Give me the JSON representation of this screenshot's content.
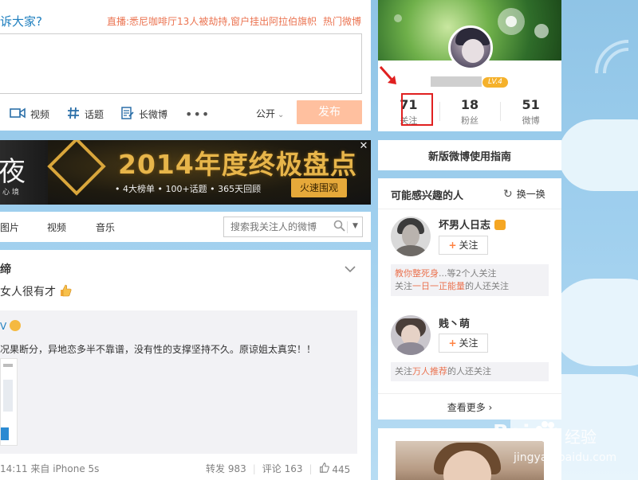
{
  "publisher": {
    "prompt": "诉大家?",
    "news": "直播:悉尼咖啡厅13人被劫持,窗户挂出阿拉伯旗帜",
    "hot": "热门微博",
    "tools": [
      {
        "label": "视频",
        "icon": "video-icon"
      },
      {
        "label": "话题",
        "icon": "hashtag-icon"
      },
      {
        "label": "长微博",
        "icon": "long-post-icon"
      }
    ],
    "more": "•••",
    "visibility": "公开",
    "publish": "发布"
  },
  "banner": {
    "left_big": "夜",
    "left_small": "心 境",
    "title": "2014年度终极盘点",
    "sub": "• 4大榜单 • 100+话题 • 365天回顾",
    "cta": "火速围观",
    "close": "✕"
  },
  "feed_tabs": {
    "items": [
      "图片",
      "视频",
      "音乐"
    ],
    "search_placeholder": "搜索我关注人的微博"
  },
  "feed": {
    "name": "缔",
    "text": "女人很有才",
    "repost_head": "V",
    "repost_text": "况果断分，异地恋多半不靠谱，没有性的支撑坚持不久。原谅姐太真实！！",
    "meta": "14:11 来自 iPhone 5s",
    "actions": {
      "repost": "转发 983",
      "comment": "评论 163",
      "like": "445"
    }
  },
  "profile": {
    "level": "LV.4",
    "stats": [
      {
        "num": "71",
        "label": "关注"
      },
      {
        "num": "18",
        "label": "粉丝"
      },
      {
        "num": "51",
        "label": "微博"
      }
    ]
  },
  "guide": {
    "label": "新版微博使用指南"
  },
  "suggest": {
    "title": "可能感兴趣的人",
    "refresh": "换一换",
    "people": [
      {
        "name": "坏男人日志",
        "follow": "关注",
        "reason_line1_hl": "教你整死身",
        "reason_line1_rest": "...等2个人关注",
        "reason_line2_pre": "关注",
        "reason_line2_hl": "一日一正能量",
        "reason_line2_post": "的人还关注"
      },
      {
        "name": "贱丶萌",
        "follow": "关注",
        "reason_line1_pre": "关注",
        "reason_line1_hl": "万人推荐",
        "reason_line1_post": "的人还关注"
      }
    ],
    "more": "查看更多 ›"
  },
  "watermark": {
    "main": "Bai",
    "brand": "经验",
    "url": "jingyan.baidu.com"
  }
}
